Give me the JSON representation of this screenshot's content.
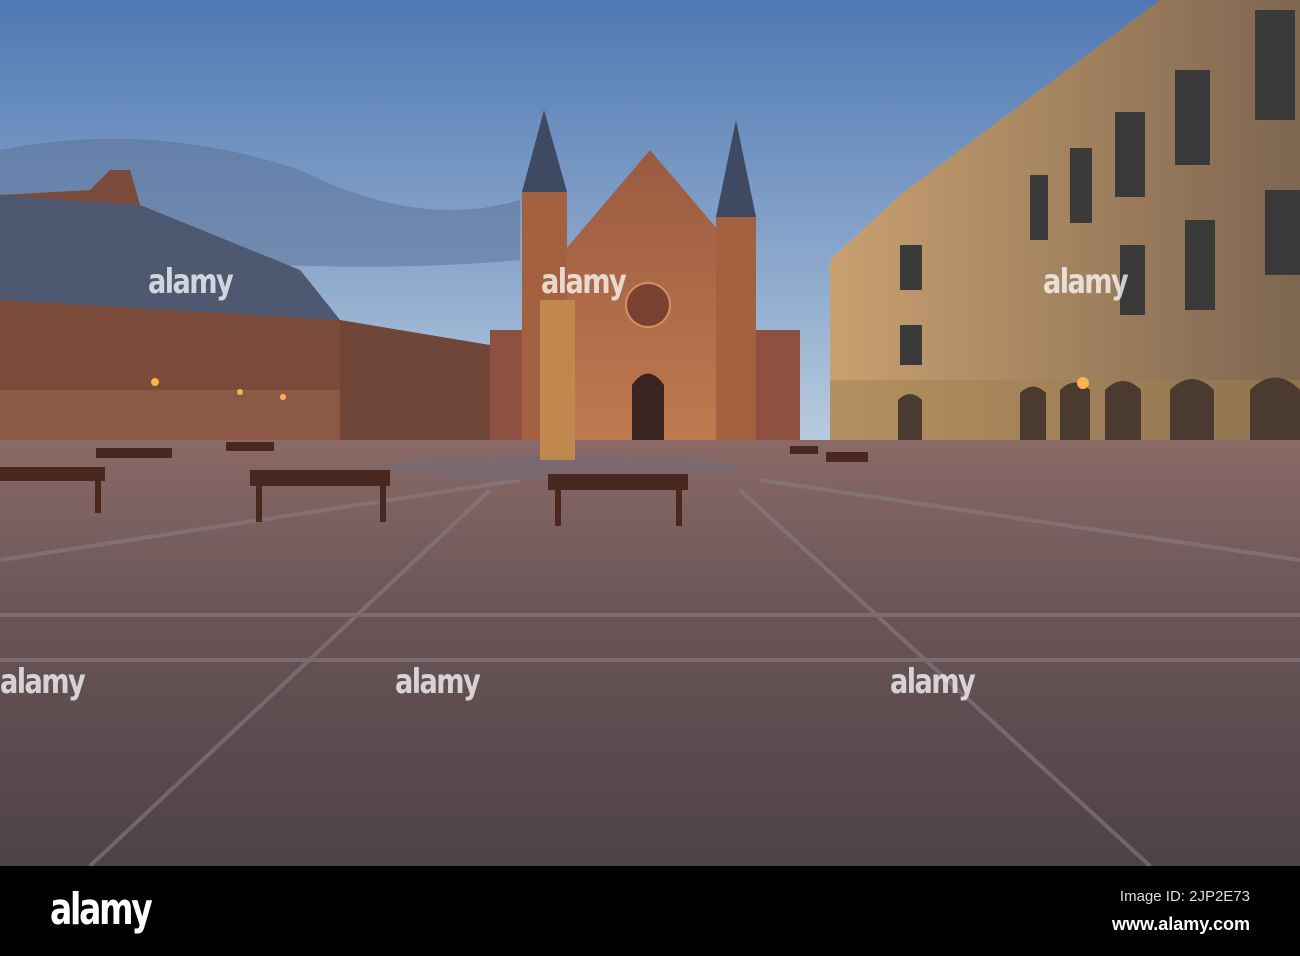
{
  "watermark": {
    "text": "alamy"
  },
  "footer": {
    "logo": "alamy",
    "image_id": "Image ID: 2JP2E73",
    "website": "www.alamy.com"
  },
  "colors": {
    "sky_top": "#4f78b3",
    "sky_horizon": "#b9cde0",
    "brick": "#8a4a36",
    "stone": "#b08a5c",
    "plaza": "#6a5558",
    "lamp": "#ffb24a"
  }
}
